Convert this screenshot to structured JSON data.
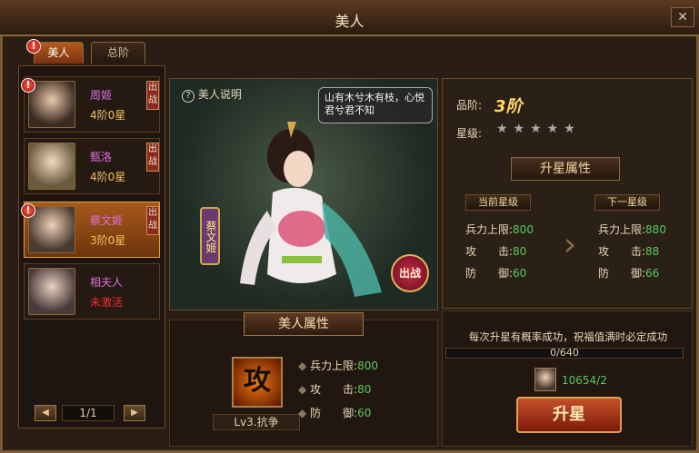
{
  "window": {
    "title": "美人",
    "close_label": "✕"
  },
  "tabs": [
    {
      "label": "美人",
      "active": true,
      "alert": true
    },
    {
      "label": "总阶",
      "active": false,
      "alert": false
    }
  ],
  "alert_glyph": "!",
  "beauties": [
    {
      "name": "周姬",
      "status": "4阶0星",
      "name_color": "#e070e0",
      "status_color": "#f0c060",
      "deploy_label": "出战",
      "alert": true,
      "selected": false
    },
    {
      "name": "甄洛",
      "status": "4阶0星",
      "name_color": "#e070e0",
      "status_color": "#f0c060",
      "deploy_label": "出战",
      "alert": false,
      "selected": false
    },
    {
      "name": "蔡文姬",
      "status": "3阶0星",
      "name_color": "#e070e0",
      "status_color": "#f0c060",
      "deploy_label": "出战",
      "alert": true,
      "selected": true
    },
    {
      "name": "相夫人",
      "status": "未激活",
      "name_color": "#e070e0",
      "status_color": "#e83030",
      "deploy_label": "",
      "alert": false,
      "selected": false
    }
  ],
  "pager": {
    "prev": "◀",
    "next": "▶",
    "page": "1/1"
  },
  "center": {
    "help_icon": "?",
    "help_label": "美人说明",
    "quote": "山有木兮木有枝，心悦君兮君不知",
    "name_vertical": "蔡文姬",
    "fight_label": "出战",
    "attr_header": "美人属性",
    "skill_glyph": "攻",
    "skill_label": "Lv3.抗争",
    "attrs": [
      {
        "label": "兵力上限:",
        "value": "800"
      },
      {
        "label": "攻　　击:",
        "value": "80"
      },
      {
        "label": "防　　御:",
        "value": "60"
      }
    ]
  },
  "right": {
    "grade_label": "品阶:",
    "grade_value": "3阶",
    "star_label": "星级:",
    "stars": "★★★★★",
    "upgrade_attr_header": "升星属性",
    "current_header": "当前星级",
    "next_header": "下一星级",
    "current": [
      {
        "label": "兵力上限:",
        "value": "800"
      },
      {
        "label": "攻　　击:",
        "value": "80"
      },
      {
        "label": "防　　御:",
        "value": "60"
      }
    ],
    "next": [
      {
        "label": "兵力上限:",
        "value": "880"
      },
      {
        "label": "攻　　击:",
        "value": "88"
      },
      {
        "label": "防　　御:",
        "value": "66"
      }
    ],
    "arrow": "›",
    "note": "每次升星有概率成功，祝福值满时必定成功",
    "progress_text": "0/640",
    "progress": 0,
    "owned": "10654/2",
    "upgrade_button": "升星"
  },
  "colors": {
    "accent": "#b35a1c",
    "value_green": "#5ac85a",
    "gold": "#ffd86a"
  }
}
